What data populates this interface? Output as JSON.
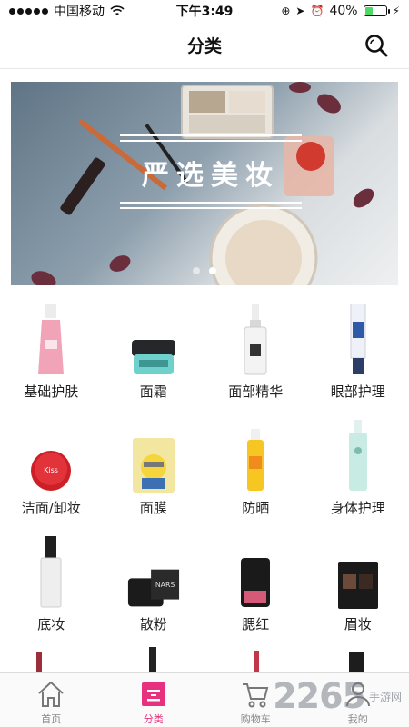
{
  "status_bar": {
    "carrier": "中国移动",
    "time": "下午3:49",
    "battery": "40%",
    "battery_level": 0.4
  },
  "nav": {
    "title": "分类",
    "search_icon": "search-icon"
  },
  "banner": {
    "title": "严选美妆",
    "page_count": 2,
    "active_page": 2
  },
  "categories": [
    {
      "label": "基础护肤",
      "icon": "lotion-bottle"
    },
    {
      "label": "面霜",
      "icon": "cream-jar"
    },
    {
      "label": "面部精华",
      "icon": "serum-bottle"
    },
    {
      "label": "眼部护理",
      "icon": "eye-cream-tube"
    },
    {
      "label": "洁面/卸妆",
      "icon": "cushion-compact"
    },
    {
      "label": "面膜",
      "icon": "face-mask-pack"
    },
    {
      "label": "防晒",
      "icon": "sunscreen-tube"
    },
    {
      "label": "身体护理",
      "icon": "body-lotion"
    },
    {
      "label": "底妆",
      "icon": "foundation-bottle"
    },
    {
      "label": "散粉",
      "icon": "powder-box"
    },
    {
      "label": "腮红",
      "icon": "blush-case"
    },
    {
      "label": "眉妆",
      "icon": "brow-palette"
    }
  ],
  "tab_bar": {
    "items": [
      {
        "label": "首页",
        "icon": "home-icon",
        "active": false
      },
      {
        "label": "分类",
        "icon": "category-icon",
        "active": true
      },
      {
        "label": "购物车",
        "icon": "cart-icon",
        "active": false
      },
      {
        "label": "我的",
        "icon": "profile-icon",
        "active": false
      }
    ]
  },
  "watermark": {
    "number": "2265",
    "text": "手游网"
  },
  "colors": {
    "accent": "#e8317e",
    "battery_green": "#4cd964"
  }
}
